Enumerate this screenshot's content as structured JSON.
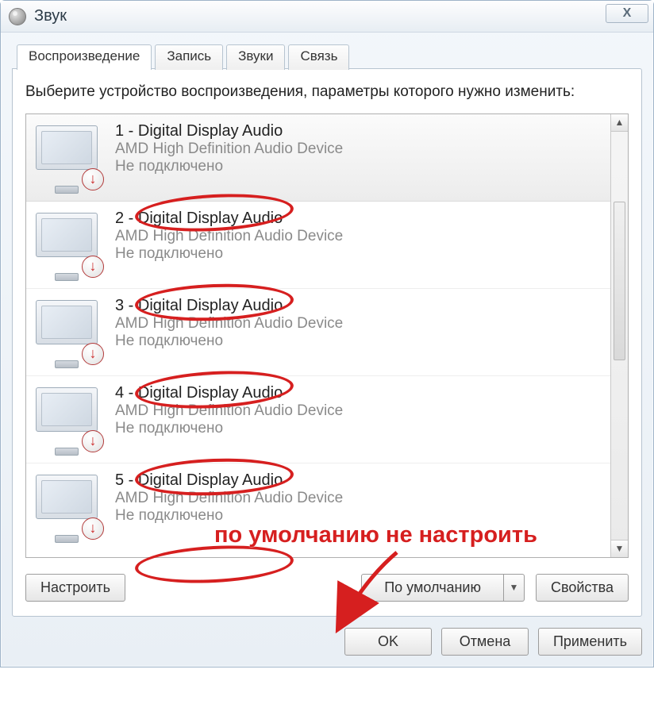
{
  "title": "Звук",
  "close_glyph": "X",
  "tabs": {
    "playback": "Воспроизведение",
    "record": "Запись",
    "sounds": "Звуки",
    "comm": "Связь"
  },
  "instruction": "Выберите устройство воспроизведения, параметры которого нужно изменить:",
  "devices": [
    {
      "name": "1 - Digital Display Audio",
      "driver": "AMD High Definition Audio Device",
      "status": "Не подключено"
    },
    {
      "name": "2 - Digital Display Audio",
      "driver": "AMD High Definition Audio Device",
      "status": "Не подключено"
    },
    {
      "name": "3 - Digital Display Audio",
      "driver": "AMD High Definition Audio Device",
      "status": "Не подключено"
    },
    {
      "name": "4 - Digital Display Audio",
      "driver": "AMD High Definition Audio Device",
      "status": "Не подключено"
    },
    {
      "name": "5 - Digital Display Audio",
      "driver": "AMD High Definition Audio Device",
      "status": "Не подключено"
    }
  ],
  "buttons": {
    "configure": "Настроить",
    "default": "По умолчанию",
    "properties": "Свойства",
    "ok": "OK",
    "cancel": "Отмена",
    "apply": "Применить"
  },
  "annotation_text": "по умолчанию не настроить",
  "badge_glyph": "↓"
}
